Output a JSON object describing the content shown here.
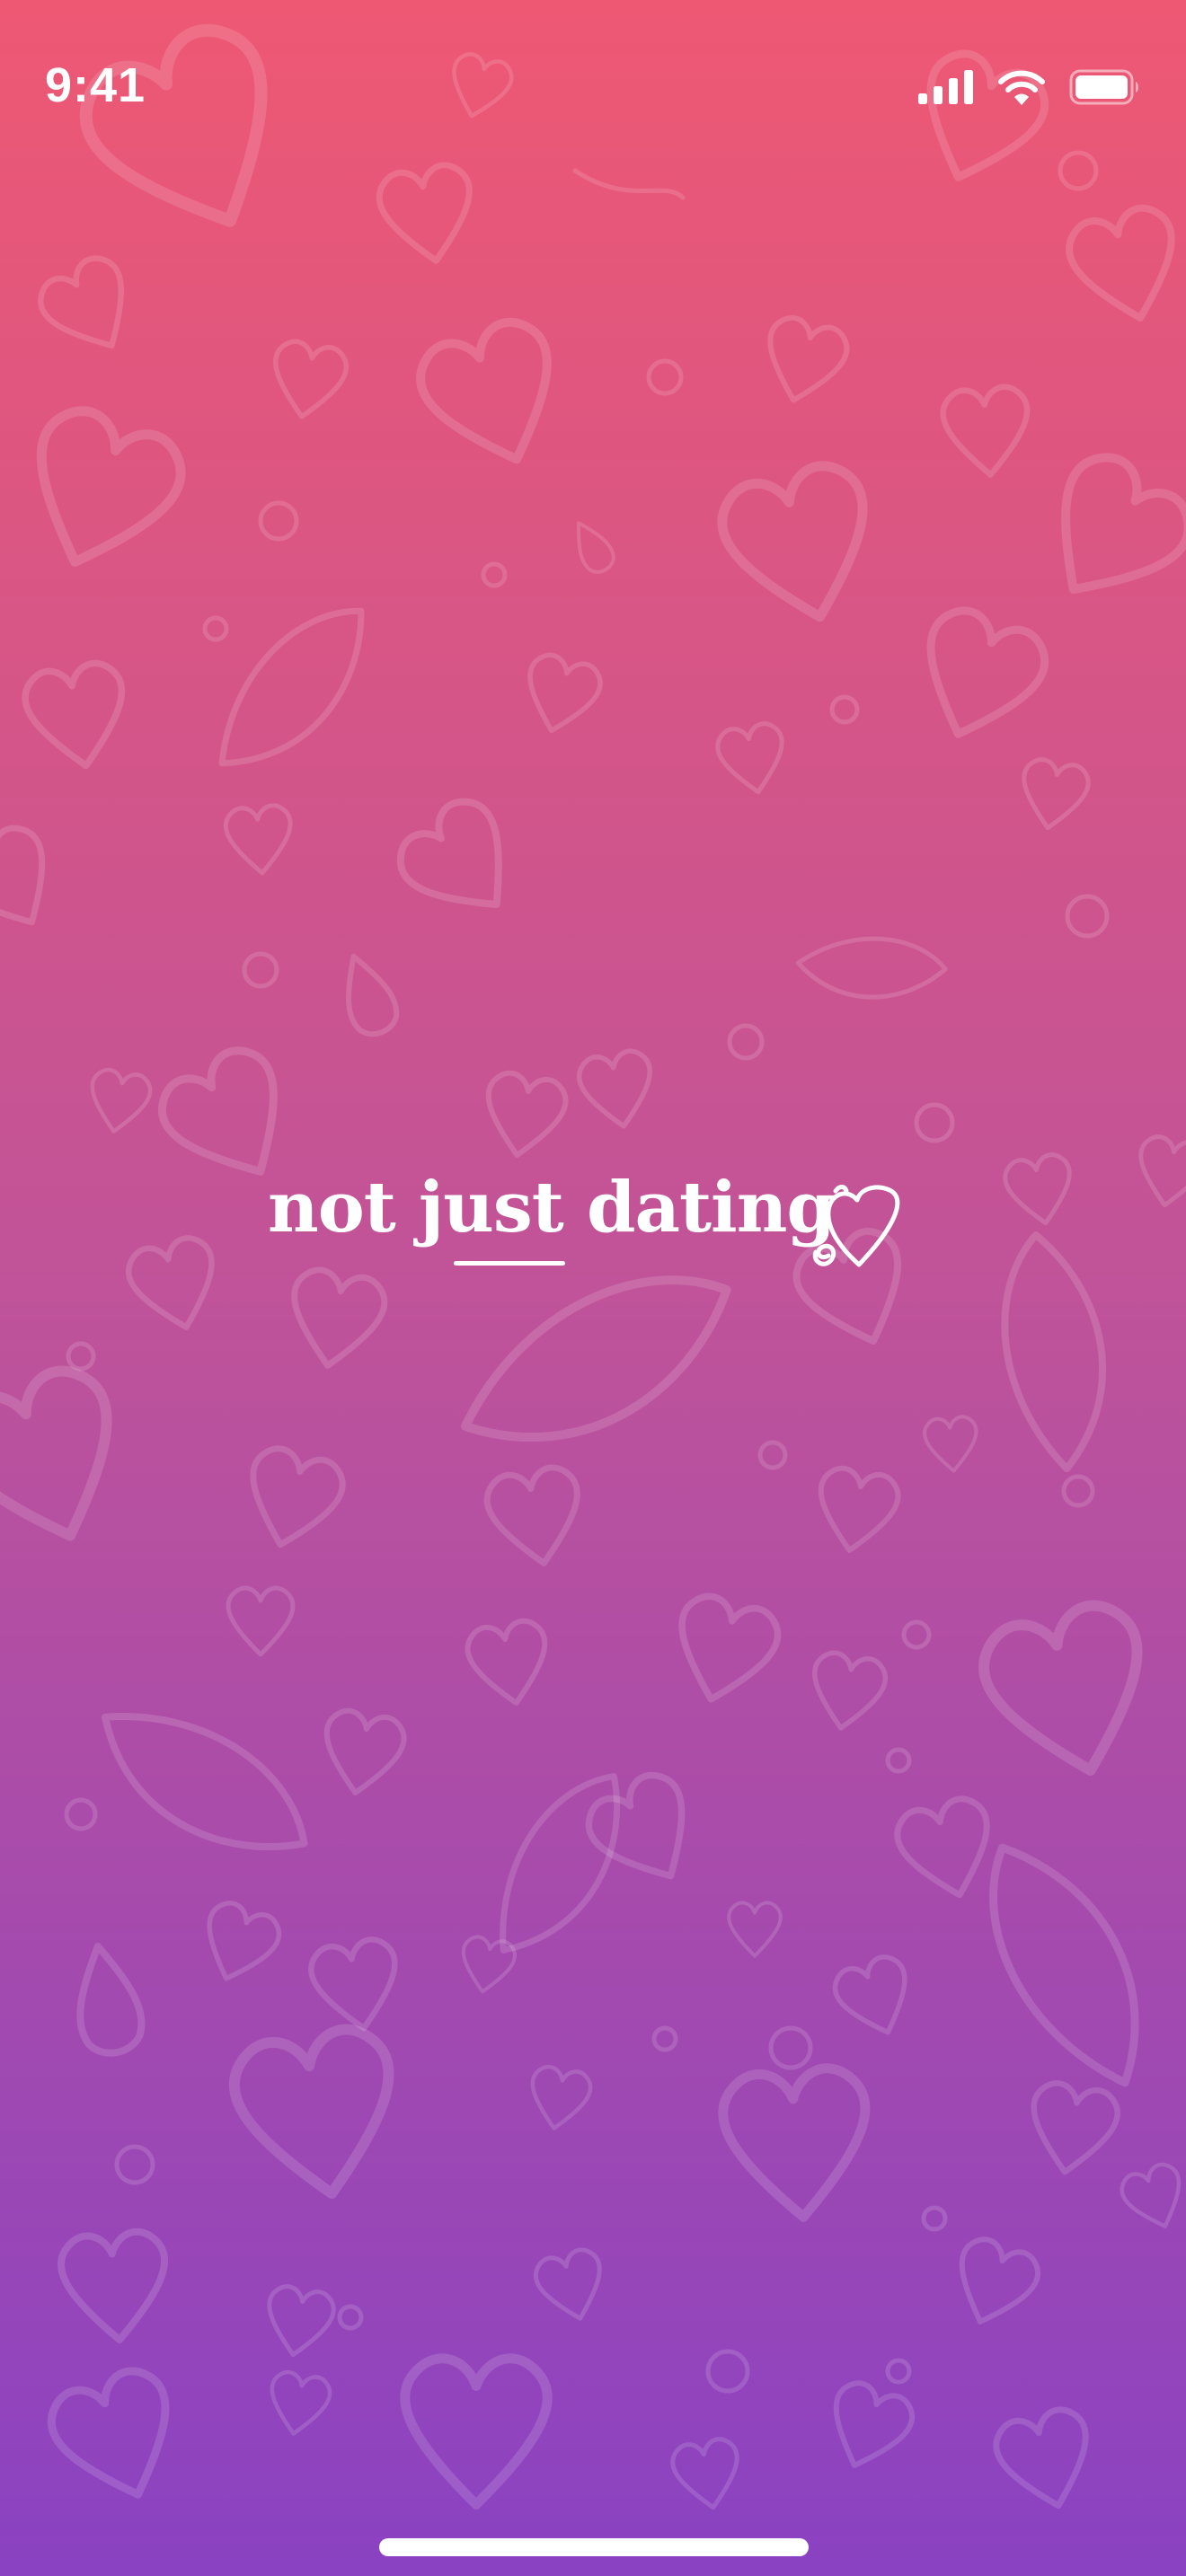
{
  "app": {
    "logo_text": "not just dating",
    "logo_emphasis_word": "just"
  },
  "status_bar": {
    "time": "9:41",
    "icons": [
      "cellular-signal-icon",
      "wifi-icon",
      "battery-icon"
    ]
  },
  "theme": {
    "gradient_top": "#EE5873",
    "gradient_mid": "#C05399",
    "gradient_bottom": "#8A42C2",
    "pattern_stroke": "#FFFFFF",
    "pattern_opacity": 0.14,
    "foreground": "#FFFFFF"
  },
  "background_pattern": {
    "motif": "heart-doodle-icon"
  }
}
